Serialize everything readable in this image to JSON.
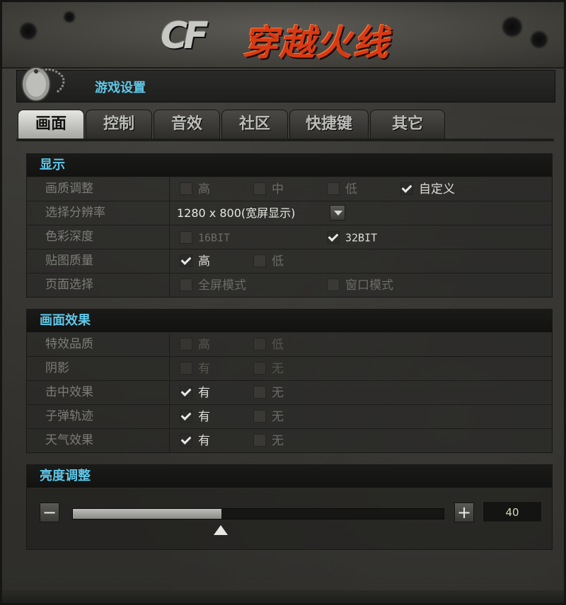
{
  "window": {
    "game_title": "穿越火线",
    "logo_cf": "CF",
    "settings_title": "游戏设置"
  },
  "tabs": [
    {
      "label": "画面",
      "active": true
    },
    {
      "label": "控制",
      "active": false
    },
    {
      "label": "音效",
      "active": false
    },
    {
      "label": "社区",
      "active": false
    },
    {
      "label": "快捷键",
      "active": false
    },
    {
      "label": "其它",
      "active": false
    }
  ],
  "display": {
    "heading": "显示",
    "rows": [
      {
        "label": "画质调整",
        "options": [
          {
            "text": "高",
            "checked": false,
            "enabled": false
          },
          {
            "text": "中",
            "checked": false,
            "enabled": false
          },
          {
            "text": "低",
            "checked": false,
            "enabled": false
          },
          {
            "text": "自定义",
            "checked": true,
            "enabled": true
          }
        ]
      },
      {
        "label": "选择分辨率",
        "select_value": "1280 x 800(宽屏显示)"
      },
      {
        "label": "色彩深度",
        "options": [
          {
            "text": "16BIT",
            "checked": false,
            "enabled": false
          },
          {
            "text": "32BIT",
            "checked": true,
            "enabled": true
          }
        ]
      },
      {
        "label": "贴图质量",
        "options": [
          {
            "text": "高",
            "checked": true,
            "enabled": true
          },
          {
            "text": "低",
            "checked": false,
            "enabled": false
          }
        ]
      },
      {
        "label": "页面选择",
        "options": [
          {
            "text": "全屏模式",
            "checked": false,
            "enabled": false
          },
          {
            "text": "窗口模式",
            "checked": false,
            "enabled": false
          }
        ]
      }
    ]
  },
  "effects": {
    "heading": "画面效果",
    "rows": [
      {
        "label": "特效品质",
        "options": [
          {
            "text": "高",
            "checked": false,
            "enabled": false
          },
          {
            "text": "低",
            "checked": false,
            "enabled": false
          }
        ]
      },
      {
        "label": "阴影",
        "options": [
          {
            "text": "有",
            "checked": false,
            "enabled": false
          },
          {
            "text": "无",
            "checked": false,
            "enabled": false
          }
        ]
      },
      {
        "label": "击中效果",
        "options": [
          {
            "text": "有",
            "checked": true,
            "enabled": true
          },
          {
            "text": "无",
            "checked": false,
            "enabled": false
          }
        ]
      },
      {
        "label": "子弹轨迹",
        "options": [
          {
            "text": "有",
            "checked": true,
            "enabled": true
          },
          {
            "text": "无",
            "checked": false,
            "enabled": false
          }
        ]
      },
      {
        "label": "天气效果",
        "options": [
          {
            "text": "有",
            "checked": true,
            "enabled": true
          },
          {
            "text": "无",
            "checked": false,
            "enabled": false
          }
        ]
      }
    ]
  },
  "brightness": {
    "heading": "亮度调整",
    "minus": "−",
    "plus": "+",
    "value": "40",
    "fraction": 0.4
  }
}
